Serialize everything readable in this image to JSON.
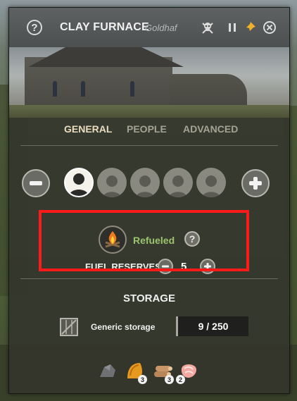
{
  "window": {
    "title": "CLAY FURNACE",
    "subtitle": "Goldhaf",
    "help_glyph": "?",
    "icons": [
      "question-icon",
      "skull-icon",
      "pause-icon",
      "pin-icon",
      "close-icon"
    ]
  },
  "tabs": [
    {
      "label": "GENERAL",
      "active": true
    },
    {
      "label": "PEOPLE",
      "active": false
    },
    {
      "label": "ADVANCED",
      "active": false
    }
  ],
  "workers": {
    "assigned": 1,
    "slots": 5
  },
  "fuel": {
    "status": "Refueled",
    "status_color": "#9bc46f",
    "help_glyph": "?",
    "reserves_label": "FUEL RESERVES",
    "reserves_value": "5"
  },
  "storage": {
    "title": "STORAGE",
    "label": "Generic storage",
    "value": "9 / 250"
  },
  "resources": [
    {
      "icon": "stone-icon",
      "count": ""
    },
    {
      "icon": "clay-icon",
      "count": "3"
    },
    {
      "icon": "logs-icon",
      "count": "3"
    },
    {
      "icon": "meat-icon",
      "count": "2"
    }
  ],
  "colors": {
    "highlight": "#ff1a1a",
    "active_tab": "#e9dcc0"
  }
}
